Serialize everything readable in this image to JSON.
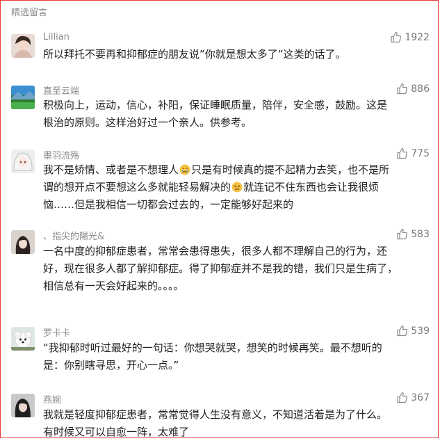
{
  "section_title": "精选留言",
  "comments": [
    {
      "name": "Lillian",
      "likes": "1922",
      "lines": [
        "所以拜托不要再和抑郁症的朋友说”你就是想太多了”这类的话了。"
      ]
    },
    {
      "name": "直至云端",
      "likes": "886",
      "lines": [
        "积极向上，运动，信心，补阳，保证睡眠质量，陪伴，安全感，鼓励。这是",
        "根治的原则。这样治好过一个亲人。供参考。"
      ]
    },
    {
      "name": "墨羽流殇",
      "likes": "775",
      "line1a": "我不是矫情、或者是不想理人",
      "line1b": "只是有时候真的提不起精力去笑，也不是所",
      "line2a": "谓的想开点不要想这么多就能轻易解决的",
      "line2b": "就连记不住东西也会让我很烦",
      "line3": "恼……但是我相信一切都会过去的，一定能够好起来的"
    },
    {
      "name": "、指尖的陽光&",
      "likes": "583",
      "lines": [
        "一名中度的抑郁症患者，常常会患得患失，很多人都不理解自己的行为，还",
        "好，现在很多人都了解抑郁症。得了抑郁症并不是我的错，我们只是生病了，",
        "相信总有一天会好起来的。。。。"
      ]
    },
    {
      "name": "罗卡卡",
      "likes": "539",
      "lines": [
        "“我抑郁时听过最好的一句话：你想哭就哭，想笑的时候再笑。最不想听的",
        "是：你别瞎寻思，开心一点。”"
      ]
    },
    {
      "name": "燕婉",
      "likes": "367",
      "lines": [
        "我就是轻度抑郁症患者，常常觉得人生没有意义，不知道活着是为了什么。",
        "有时候又可以自愈一阵，太难了"
      ]
    }
  ],
  "emoji": {
    "crying": "crying-face",
    "persevering": "persevering-face"
  }
}
